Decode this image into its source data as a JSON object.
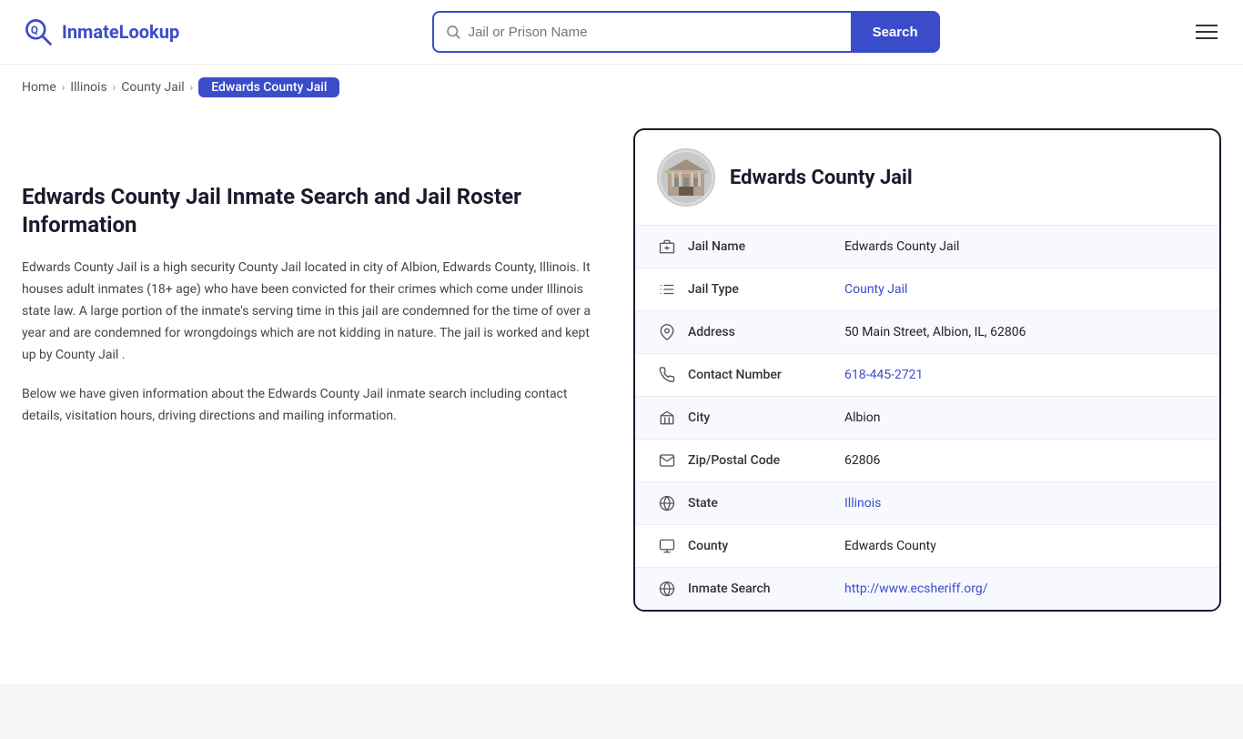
{
  "header": {
    "logo_text_part1": "Inmate",
    "logo_text_part2": "Lookup",
    "search_placeholder": "Jail or Prison Name",
    "search_button_label": "Search"
  },
  "breadcrumb": {
    "home": "Home",
    "level1": "Illinois",
    "level2": "County Jail",
    "current": "Edwards County Jail"
  },
  "left": {
    "title": "Edwards County Jail Inmate Search and Jail Roster Information",
    "desc1": "Edwards County Jail is a high security County Jail located in city of Albion, Edwards County, Illinois. It houses adult inmates (18+ age) who have been convicted for their crimes which come under Illinois state law. A large portion of the inmate's serving time in this jail are condemned for the time of over a year and are condemned for wrongdoings which are not kidding in nature. The jail is worked and kept up by County Jail .",
    "desc2": "Below we have given information about the Edwards County Jail inmate search including contact details, visitation hours, driving directions and mailing information."
  },
  "card": {
    "title": "Edwards County Jail",
    "rows": [
      {
        "icon": "building-icon",
        "label": "Jail Name",
        "value": "Edwards County Jail",
        "link": null
      },
      {
        "icon": "list-icon",
        "label": "Jail Type",
        "value": "County Jail",
        "link": "#"
      },
      {
        "icon": "location-icon",
        "label": "Address",
        "value": "50 Main Street, Albion, IL, 62806",
        "link": null
      },
      {
        "icon": "phone-icon",
        "label": "Contact Number",
        "value": "618-445-2721",
        "link": "tel:618-445-2721"
      },
      {
        "icon": "city-icon",
        "label": "City",
        "value": "Albion",
        "link": null
      },
      {
        "icon": "mail-icon",
        "label": "Zip/Postal Code",
        "value": "62806",
        "link": null
      },
      {
        "icon": "globe-icon",
        "label": "State",
        "value": "Illinois",
        "link": "#"
      },
      {
        "icon": "county-icon",
        "label": "County",
        "value": "Edwards County",
        "link": null
      },
      {
        "icon": "search-globe-icon",
        "label": "Inmate Search",
        "value": "http://www.ecsheriff.org/",
        "link": "http://www.ecsheriff.org/"
      }
    ]
  }
}
